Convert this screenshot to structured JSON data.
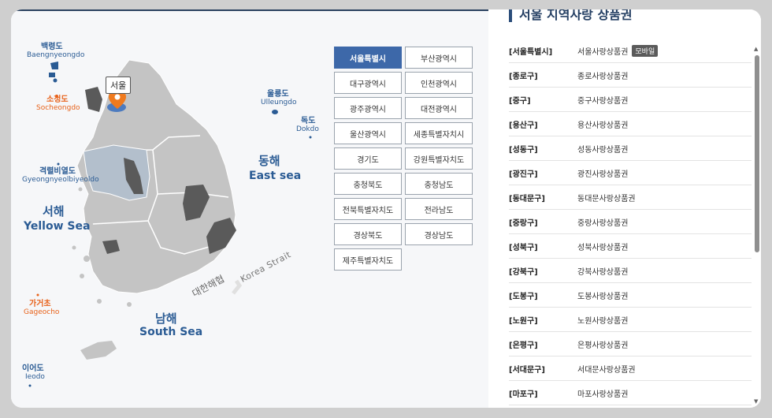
{
  "map": {
    "seoul_tag": "서울",
    "places": {
      "baengnyeongdo_ko": "백령도",
      "baengnyeongdo_en": "Baengnyeongdo",
      "socheongdo_ko": "소청도",
      "socheongdo_en": "Socheongdo",
      "gyeokyeolbiyeoldo_ko": "격렬비열도",
      "gyeokyeolbiyeoldo_en": "Gyeongnyeolbiyeoldo",
      "ulleungdo_ko": "울릉도",
      "ulleungdo_en": "Ulleungdo",
      "dokdo_ko": "독도",
      "dokdo_en": "Dokdo",
      "gageocho_ko": "가거초",
      "gageocho_en": "Gageocho",
      "ieodo_ko": "이어도",
      "ieodo_en": "Ieodo"
    },
    "seas": {
      "east_ko": "동해",
      "east_en": "East sea",
      "west_ko": "서해",
      "west_en": "Yellow Sea",
      "south_ko": "남해",
      "south_en": "South Sea"
    },
    "strait_ko": "대한해협",
    "strait_en": "Korea Strait",
    "colors": {
      "land": "#c4c4c4",
      "highlight": "#b3bfcc",
      "dark": "#5a5a5a",
      "marker": "#f07a1e",
      "seoul": "#4d7bbf"
    }
  },
  "regions": [
    {
      "label": "서울특별시",
      "active": true
    },
    {
      "label": "부산광역시",
      "active": false
    },
    {
      "label": "대구광역시",
      "active": false
    },
    {
      "label": "인천광역시",
      "active": false
    },
    {
      "label": "광주광역시",
      "active": false
    },
    {
      "label": "대전광역시",
      "active": false
    },
    {
      "label": "울산광역시",
      "active": false
    },
    {
      "label": "세종특별자치시",
      "active": false
    },
    {
      "label": "경기도",
      "active": false
    },
    {
      "label": "강원특별자치도",
      "active": false
    },
    {
      "label": "충청북도",
      "active": false
    },
    {
      "label": "충청남도",
      "active": false
    },
    {
      "label": "전북특별자치도",
      "active": false
    },
    {
      "label": "전라남도",
      "active": false
    },
    {
      "label": "경상북도",
      "active": false
    },
    {
      "label": "경상남도",
      "active": false
    },
    {
      "label": "제주특별자치도",
      "active": false
    }
  ],
  "list": {
    "title": "서울 지역사랑 상품권",
    "rows": [
      {
        "district": "[서울특별시]",
        "voucher": "서울사랑상품권",
        "badge": "모바일"
      },
      {
        "district": "[종로구]",
        "voucher": "종로사랑상품권"
      },
      {
        "district": "[중구]",
        "voucher": "중구사랑상품권"
      },
      {
        "district": "[용산구]",
        "voucher": "용산사랑상품권"
      },
      {
        "district": "[성동구]",
        "voucher": "성동사랑상품권"
      },
      {
        "district": "[광진구]",
        "voucher": "광진사랑상품권"
      },
      {
        "district": "[동대문구]",
        "voucher": "동대문사랑상품권"
      },
      {
        "district": "[중랑구]",
        "voucher": "중랑사랑상품권"
      },
      {
        "district": "[성북구]",
        "voucher": "성북사랑상품권"
      },
      {
        "district": "[강북구]",
        "voucher": "강북사랑상품권"
      },
      {
        "district": "[도봉구]",
        "voucher": "도봉사랑상품권"
      },
      {
        "district": "[노원구]",
        "voucher": "노원사랑상품권"
      },
      {
        "district": "[은평구]",
        "voucher": "은평사랑상품권"
      },
      {
        "district": "[서대문구]",
        "voucher": "서대문사랑상품권"
      },
      {
        "district": "[마포구]",
        "voucher": "마포사랑상품권"
      }
    ]
  }
}
